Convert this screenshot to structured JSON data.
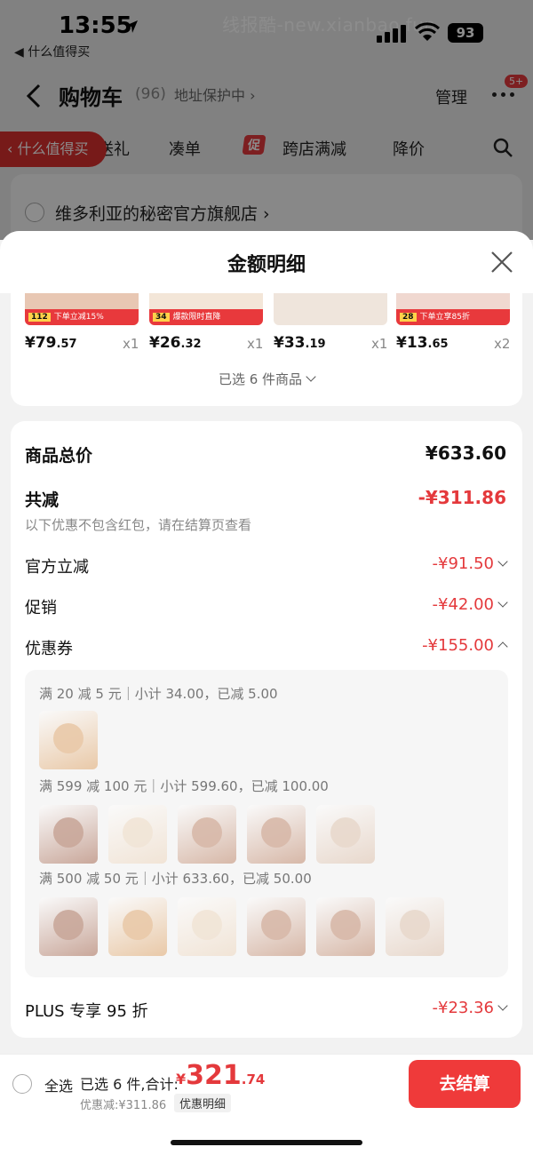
{
  "status_bar": {
    "time": "13:55",
    "battery": "93",
    "watermark": "线报酷-new.xianbao.fun",
    "back_app": "◀ 什么值得买"
  },
  "nav": {
    "title": "购物车",
    "count": "(96)",
    "address": "地址保护中 ›",
    "manage": "管理",
    "badge": "5+"
  },
  "tabs": [
    "送礼",
    "凑单",
    "跨店满减",
    "降价"
  ],
  "tab_tag": "促",
  "smzdm_pill": "什么值得买",
  "shop_name": "维多利亚的秘密官方旗舰店 ›",
  "sheet": {
    "title": "金额明细"
  },
  "products": [
    {
      "int": "¥79",
      "dec": ".57",
      "qty": "x1",
      "tag_left": "112",
      "tag_right": "下单立减15%",
      "color": "#e8c7b3"
    },
    {
      "int": "¥26",
      "dec": ".32",
      "qty": "x1",
      "tag_left": "34",
      "tag_right": "爆款限时直降",
      "color": "#f3e6d8"
    },
    {
      "int": "¥33",
      "dec": ".19",
      "qty": "x1",
      "tag_left": "",
      "tag_right": "",
      "color": "#efe5dc"
    },
    {
      "int": "¥13",
      "dec": ".65",
      "qty": "x2",
      "tag_left": "28",
      "tag_right": "下单立享85折",
      "color": "#f0d8d0"
    }
  ],
  "selected_count": "已选 6 件商品",
  "summary": {
    "goods_total_label": "商品总价",
    "goods_total": "¥633.60",
    "total_reduce_label": "共减",
    "total_reduce": "-¥311.86",
    "note": "以下优惠不包含红包，请在结算页查看",
    "official_label": "官方立减",
    "official": "-¥91.50",
    "promo_label": "促销",
    "promo": "-¥42.00",
    "coupon_label": "优惠券",
    "coupon": "-¥155.00",
    "plus_label": "PLUS 专享 95 折",
    "plus": "-¥23.36"
  },
  "coupon_groups": [
    {
      "line": "满 20 减 5 元｜小计 34.00，已减 5.00",
      "thumbs": [
        "#e9c9a8"
      ]
    },
    {
      "line": "满 599 减 100 元｜小计 599.60，已减 100.00",
      "thumbs": [
        "#c9a79a",
        "#f1e4d6",
        "#d7b8a8",
        "#d7b8a8",
        "#e8d8cc"
      ]
    },
    {
      "line": "满 500 减 50 元｜小计 633.60，已减 50.00",
      "thumbs": [
        "#c9a79a",
        "#e9c9a8",
        "#f1e4d6",
        "#d7b8a8",
        "#d7b8a8",
        "#e8d8cc"
      ]
    }
  ],
  "bottom": {
    "select_all": "全选",
    "selected": "已选 6 件,合计:",
    "currency": "¥",
    "total_int": "321",
    "total_dec": ".74",
    "discount_note": "优惠减:¥311.86",
    "detail_btn": "优惠明细",
    "checkout": "去结算"
  },
  "colors": {
    "accent": "#e4393c",
    "checkout": "#ef3a3a"
  }
}
